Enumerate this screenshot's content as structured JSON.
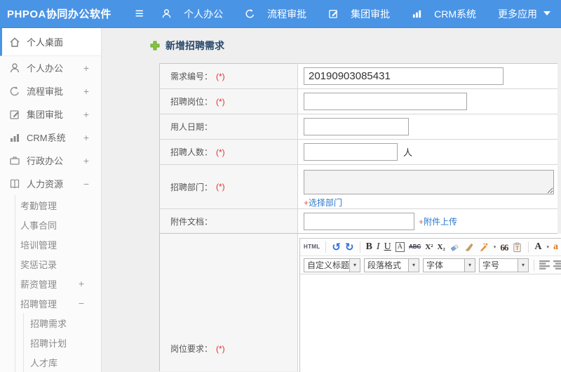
{
  "topbar": {
    "brand": "PHPOA协同办公软件",
    "hamburger_icon": "≡",
    "nav": [
      {
        "label": "个人办公"
      },
      {
        "label": "流程审批"
      },
      {
        "label": "集团审批"
      },
      {
        "label": "CRM系统"
      },
      {
        "label": "更多应用"
      }
    ]
  },
  "sidebar": {
    "items": [
      {
        "label": "个人桌面"
      },
      {
        "label": "个人办公",
        "expander": "+"
      },
      {
        "label": "流程审批",
        "expander": "+"
      },
      {
        "label": "集团审批",
        "expander": "+"
      },
      {
        "label": "CRM系统",
        "expander": "+"
      },
      {
        "label": "行政办公",
        "expander": "+"
      },
      {
        "label": "人力资源",
        "expander": "−"
      }
    ],
    "hr_children": [
      {
        "label": "考勤管理"
      },
      {
        "label": "人事合同"
      },
      {
        "label": "培训管理"
      },
      {
        "label": "奖惩记录"
      },
      {
        "label": "薪资管理",
        "expander": "+"
      },
      {
        "label": "招聘管理",
        "expander": "−"
      }
    ],
    "recruit_children": [
      {
        "label": "招聘需求"
      },
      {
        "label": "招聘计划"
      },
      {
        "label": "人才库"
      }
    ]
  },
  "page": {
    "title": "新增招聘需求"
  },
  "form": {
    "required_mark": "(*)",
    "rows": {
      "demand_no": {
        "label": "需求编号：",
        "value": "20190903085431"
      },
      "position": {
        "label": "招聘岗位："
      },
      "hire_date": {
        "label": "用人日期："
      },
      "headcount": {
        "label": "招聘人数：",
        "suffix": "人"
      },
      "department": {
        "label": "招聘部门：",
        "link_plus": "+",
        "link_text": "选择部门"
      },
      "attachment": {
        "label": "附件文档：",
        "link_plus": "+",
        "link_text": "附件上传"
      },
      "requirements": {
        "label": "岗位要求："
      }
    }
  },
  "editor": {
    "toolbar1": {
      "html": "HTML",
      "undo": "↺",
      "redo": "↻",
      "bold": "B",
      "italic": "I",
      "underline": "U",
      "font_box": "A",
      "strike": "ABC",
      "superscript": "X²",
      "subscript": "X₂",
      "quote": "66",
      "fontcolor": "A",
      "bgcolor": "a",
      "caret": "▾"
    },
    "toolbar2": {
      "heading": "自定义标题",
      "paragraph": "段落格式",
      "font": "字体",
      "size": "字号",
      "caret": "▾"
    },
    "body_text": ""
  },
  "colors": {
    "topbar_blue": "#4a94e5",
    "link_blue": "#2a79cc",
    "required_red": "#e3302e",
    "plus_green": "#7cc344"
  }
}
